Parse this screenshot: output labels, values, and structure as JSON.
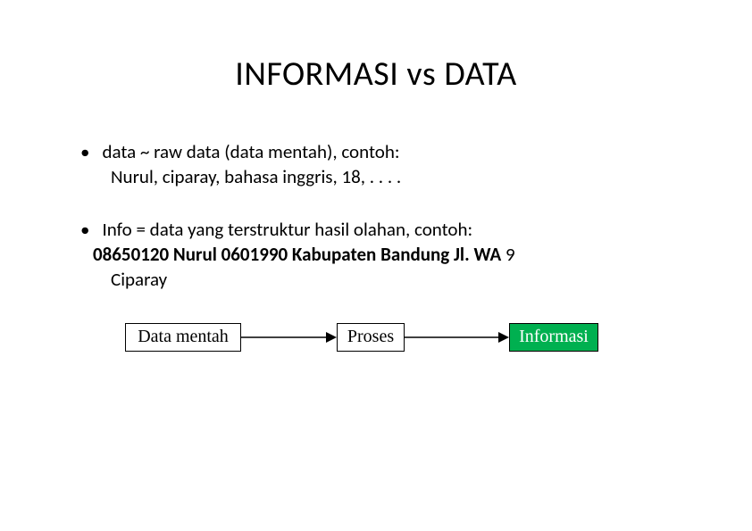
{
  "title": "INFORMASI vs DATA",
  "bullets": {
    "b1": {
      "text": "data ~ raw data (data mentah), contoh:",
      "sub": "Nurul, ciparay, bahasa inggris, 18, . . . ."
    },
    "b2": {
      "text": "Info = data yang terstruktur hasil olahan, contoh:",
      "sub_bold": "08650120 Nurul 0601990 Kabupaten Bandung Jl. WA",
      "sub_rest": " 9",
      "sub_line2": "Ciparay"
    }
  },
  "diagram": {
    "box1": "Data mentah",
    "box2": "Proses",
    "box3": "Informasi"
  }
}
